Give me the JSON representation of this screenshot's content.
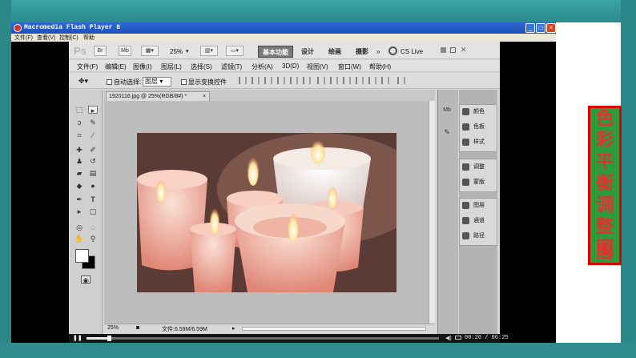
{
  "window": {
    "title": "Macromedia Flash Player 8",
    "menu": [
      "文件(F)",
      "查看(V)",
      "控制(C)",
      "帮助"
    ],
    "buttons": [
      "_",
      "□",
      "×"
    ]
  },
  "photoshop": {
    "logo": "Ps",
    "zoom_select": "25%",
    "workspaces": [
      "基本功能",
      "设计",
      "绘画",
      "摄影"
    ],
    "cs_live": "CS Live",
    "menu": [
      "文件(F)",
      "编辑(E)",
      "图像(I)",
      "图层(L)",
      "选择(S)",
      "滤镜(T)",
      "分析(A)",
      "3D(D)",
      "视图(V)",
      "窗口(W)",
      "帮助(H)"
    ],
    "options": {
      "auto_select_label": "自动选择:",
      "auto_select_value": "图层",
      "show_transform_label": "显示变换控件"
    },
    "document_tab": "1920116.jpg @ 25%(RGB/8#) *",
    "status": {
      "zoom": "25%",
      "doc_info": "文件:6.59M/6.59M"
    },
    "panels": {
      "group1": [
        "颜色",
        "色板",
        "样式"
      ],
      "group2": [
        "调整",
        "蒙版"
      ],
      "group3": [
        "图层",
        "通道",
        "路径"
      ]
    }
  },
  "player": {
    "timecode": "00:26 / 06:25",
    "progress": 0.064
  },
  "slide_title": [
    "色",
    "彩",
    "平",
    "衡",
    "调",
    "整",
    "图",
    "层"
  ],
  "colors": {
    "frame": "#2a7f83",
    "title_box_bg": "#2e9b3b",
    "title_text": "#e53030",
    "title_border": "#dd0000"
  }
}
